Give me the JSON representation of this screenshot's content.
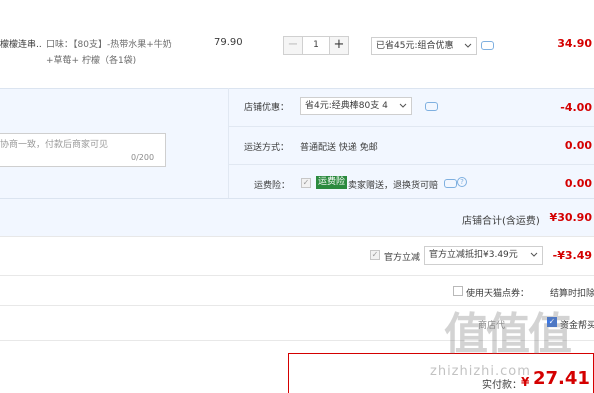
{
  "product": {
    "name": "檬檬连串...",
    "spec_line1": "口味：【80支】-热带水果+牛奶",
    "spec_line2": "+草莓+ 柠檬（各1袋)",
    "unit_price": "79.90",
    "quantity": "1",
    "minus": "−",
    "plus": "+",
    "promo_select": "已省45元:组合优惠",
    "total": "34.90"
  },
  "shop": {
    "discount_label": "店铺优惠：",
    "discount_select": "省4元:经典棒80支 4",
    "discount_amount": "-4.00",
    "message_placeholder": "协商一致，付款后商家可见",
    "message_count": "0/200",
    "shipping_label": "运送方式：",
    "shipping_value": "普通配送 快递 免邮",
    "shipping_amount": "0.00",
    "insurance_label": "运费险：",
    "insurance_badge": "运费险",
    "insurance_text": "卖家赠送，退换货可赔",
    "insurance_amount": "0.00",
    "total_label": "店铺合计(含运费)",
    "total_value": "¥30.90"
  },
  "coupon": {
    "label": "官方立减",
    "select": "官方立减抵扣¥3.49元",
    "amount": "-¥3.49"
  },
  "tmall_points": {
    "label": "使用天猫点券：",
    "right_text": "结算时扣除"
  },
  "cropped_row": {
    "left_text": "商店代",
    "right_text": "资金帮买"
  },
  "payment": {
    "label": "实付款：",
    "currency": "¥",
    "amount": "27.41"
  },
  "watermark": {
    "logo": "值值值",
    "url": "zhizhizhi.com"
  },
  "colors": {
    "price_red": "#d40000",
    "section_blue": "#f2f7ff",
    "insurance_green": "#2b8a3e"
  }
}
